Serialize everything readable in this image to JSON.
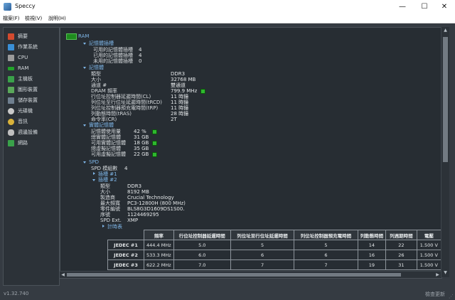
{
  "window": {
    "title": "Speccy",
    "min": "—",
    "max": "☐",
    "close": "✕"
  },
  "menu": [
    "檔案(F)",
    "檢視(V)",
    "說明(H)"
  ],
  "sidebar": {
    "items": [
      {
        "label": "摘要",
        "icon": "summary-icon",
        "color": "#d34a2e"
      },
      {
        "label": "作業系統",
        "icon": "windows-icon",
        "color": "#3a8fd6"
      },
      {
        "label": "CPU",
        "icon": "cpu-icon",
        "color": "#9a9a9a"
      },
      {
        "label": "RAM",
        "icon": "ram-icon",
        "color": "#22a22a"
      },
      {
        "label": "主機板",
        "icon": "motherboard-icon",
        "color": "#3aa14a"
      },
      {
        "label": "圖形裝置",
        "icon": "monitor-icon",
        "color": "#5aa85a"
      },
      {
        "label": "儲存裝置",
        "icon": "disk-icon",
        "color": "#6f7f8f"
      },
      {
        "label": "光碟機",
        "icon": "optical-drive-icon",
        "color": "#c9c9c9"
      },
      {
        "label": "音訊",
        "icon": "audio-icon",
        "color": "#d9b23a"
      },
      {
        "label": "週邊設備",
        "icon": "mouse-icon",
        "color": "#bfbfbf"
      },
      {
        "label": "網路",
        "icon": "network-icon",
        "color": "#3aa14a"
      }
    ]
  },
  "main": {
    "root": "RAM",
    "slots": {
      "header": "記憶體插槽",
      "rows": [
        {
          "label": "可用的記憶體插槽",
          "value": "4"
        },
        {
          "label": "已用的記憶體插槽",
          "value": "4"
        },
        {
          "label": "未用的記憶體插槽",
          "value": "0"
        }
      ]
    },
    "memory": {
      "header": "記憶體",
      "rows": [
        {
          "label": "類型",
          "value": "DDR3"
        },
        {
          "label": "大小",
          "value": "32768 MB"
        },
        {
          "label": "通道 #",
          "value": "雙通道"
        },
        {
          "label": "DRAM 頻率",
          "value": "799.9 MHz"
        },
        {
          "label": "行位址控制器延遲時間(CL)",
          "value": "11 時鐘"
        },
        {
          "label": "列位址至行位址延遲時間(tRCD)",
          "value": "11 時鐘"
        },
        {
          "label": "列位址控制器預充電時間(tRP)",
          "value": "11 時鐘"
        },
        {
          "label": "列動態時間(tRAS)",
          "value": "28 時鐘"
        },
        {
          "label": "命令率(CR)",
          "value": "2T"
        }
      ]
    },
    "physical": {
      "header": "實體記憶體",
      "rows": [
        {
          "label": "記憶體使用量",
          "value": "42 %"
        },
        {
          "label": "總實體記憶體",
          "value": "31 GB"
        },
        {
          "label": "可用實體記憶體",
          "value": "18 GB"
        },
        {
          "label": "總虛擬記憶體",
          "value": "35 GB"
        },
        {
          "label": "可用虛擬記憶體",
          "value": "22 GB"
        }
      ]
    },
    "spd": {
      "header": "SPD",
      "count_label": "SPD 模組數",
      "count_value": "4",
      "slot1": "插槽 #1",
      "slot2": "插槽 #2",
      "rows": [
        {
          "label": "類型",
          "value": "DDR3"
        },
        {
          "label": "大小",
          "value": "8192 MB"
        },
        {
          "label": "製造商",
          "value": "Crucial Technology"
        },
        {
          "label": "最大頻寬",
          "value": "PC3-12800H (800 MHz)"
        },
        {
          "label": "零件編號",
          "value": "BLS8G3D1609DS1S00."
        },
        {
          "label": "序號",
          "value": "1124469295"
        },
        {
          "label": "SPD Ext.",
          "value": "XMP"
        }
      ],
      "timing_link": "計時表",
      "table": {
        "headers": [
          "",
          "頻率",
          "行位址控制器延遲時間",
          "列位址至行位址延遲時間",
          "列位址控制器預充電時間",
          "列動態時間",
          "列週期時間",
          "電壓"
        ],
        "rows": [
          [
            "JEDEC #1",
            "444.4 MHz",
            "5.0",
            "5",
            "5",
            "14",
            "22",
            "1.500 V"
          ],
          [
            "JEDEC #2",
            "533.3 MHz",
            "6.0",
            "6",
            "6",
            "16",
            "26",
            "1.500 V"
          ],
          [
            "JEDEC #3",
            "622.2 MHz",
            "7.0",
            "7",
            "7",
            "19",
            "31",
            "1.500 V"
          ]
        ]
      }
    }
  },
  "status": {
    "version": "v1.32.740",
    "update": "檢查更新"
  }
}
